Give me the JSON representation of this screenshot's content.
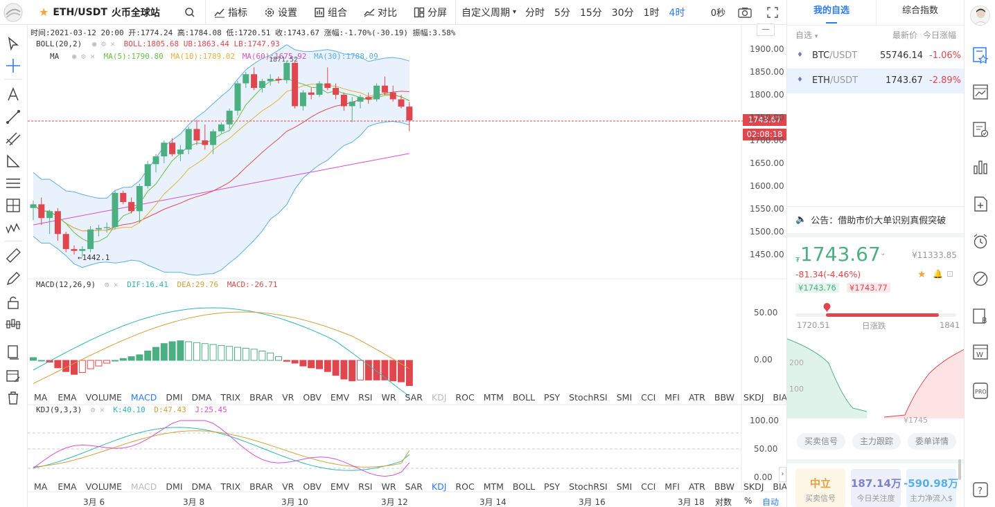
{
  "topbar": {
    "symbol": "ETH/USDT",
    "exchange": "火币全球站",
    "indicators": "指标",
    "settings": "设置",
    "combo": "组合",
    "compare": "对比",
    "split": "分屏",
    "custom_period": "自定义周期",
    "periods": [
      "分时",
      "5分",
      "15分",
      "30分",
      "1时",
      "4时"
    ],
    "active_period": "4时",
    "countdown": "0秒"
  },
  "info": {
    "ohlc": "时间:2021-03-12 20:00  开:1774.24  高:1784.08  低:1720.51  收:1743.67  涨幅:-1.70%(-30.19)  振幅:3.58%",
    "boll_name": "BOLL(20,2)",
    "boll_vals": "BOLL:1805.68  UB:1863.44  LB:1747.93",
    "ma_name": "MA",
    "ma5": "MA(5):1790.80",
    "ma10": "MA(10):1789.02",
    "ma60": "MA(60):1675.92",
    "ma30": "MA(30):1788.09",
    "high_mark": "1871.52",
    "low_mark": "←1442.1",
    "macd_name": "MACD(12,26,9)",
    "dif": "DIF:16.41",
    "dea": "DEA:29.76",
    "macd": "MACD:-26.71",
    "kdj_name": "KDJ(9,3,3)",
    "k": "K:40.10",
    "d": "D:47.43",
    "j": "J:25.45"
  },
  "price_axis": [
    "1900.00",
    "1850.00",
    "1800.00",
    "1750.00",
    "1700.00",
    "1650.00",
    "1600.00",
    "1550.00",
    "1500.00",
    "1450.00"
  ],
  "price_tag": "1743.67",
  "timer_tag": "02:08:18",
  "macd_axis": [
    "50.00",
    "0.00"
  ],
  "kdj_axis": [
    "100.00",
    "50.00",
    "0.00"
  ],
  "indicator_tabs": [
    "MA",
    "EMA",
    "VOLUME",
    "MACD",
    "DMI",
    "DMA",
    "TRIX",
    "BRAR",
    "VR",
    "OBV",
    "EMV",
    "RSI",
    "WR",
    "SAR",
    "KDJ",
    "ROC",
    "MTM",
    "BOLL",
    "PSY",
    "StochRSI",
    "SMI",
    "CCI",
    "MFI",
    "ATR",
    "BBW",
    "SKDJ",
    "BIAS",
    "DPO",
    "AO"
  ],
  "dates": [
    "3月 6",
    "3月 8",
    "3月 10",
    "3月 12",
    "3月 14",
    "3月 16",
    "3月 18"
  ],
  "bottom_right": {
    "log": "对数",
    "pct": "%",
    "auto": "自动"
  },
  "colors": {
    "up": "#4caf82",
    "down": "#e0464e",
    "accent": "#2d7bf4",
    "boll": "#5aaee6",
    "ma5": "#6bbf4a",
    "ma10": "#e2b33a",
    "ma30": "#e34c56",
    "ma60": "#d84fd0"
  },
  "chart_data": {
    "type": "candlestick",
    "candles": [
      [
        1552,
        1568,
        1525,
        1560
      ],
      [
        1560,
        1575,
        1515,
        1530
      ],
      [
        1530,
        1548,
        1495,
        1545
      ],
      [
        1545,
        1552,
        1480,
        1495
      ],
      [
        1495,
        1500,
        1455,
        1462
      ],
      [
        1462,
        1470,
        1450,
        1458
      ],
      [
        1458,
        1468,
        1445,
        1462
      ],
      [
        1462,
        1512,
        1455,
        1505
      ],
      [
        1505,
        1515,
        1490,
        1508
      ],
      [
        1508,
        1520,
        1498,
        1510
      ],
      [
        1510,
        1590,
        1505,
        1585
      ],
      [
        1585,
        1590,
        1560,
        1565
      ],
      [
        1565,
        1575,
        1540,
        1545
      ],
      [
        1545,
        1605,
        1520,
        1600
      ],
      [
        1600,
        1655,
        1595,
        1648
      ],
      [
        1648,
        1670,
        1630,
        1665
      ],
      [
        1665,
        1700,
        1650,
        1695
      ],
      [
        1695,
        1705,
        1665,
        1670
      ],
      [
        1670,
        1690,
        1655,
        1680
      ],
      [
        1680,
        1730,
        1670,
        1725
      ],
      [
        1725,
        1745,
        1690,
        1700
      ],
      [
        1700,
        1735,
        1680,
        1690
      ],
      [
        1690,
        1725,
        1670,
        1720
      ],
      [
        1720,
        1740,
        1715,
        1735
      ],
      [
        1735,
        1770,
        1725,
        1765
      ],
      [
        1765,
        1830,
        1755,
        1825
      ],
      [
        1825,
        1850,
        1815,
        1845
      ],
      [
        1845,
        1860,
        1810,
        1815
      ],
      [
        1815,
        1835,
        1805,
        1830
      ],
      [
        1830,
        1845,
        1820,
        1835
      ],
      [
        1835,
        1840,
        1825,
        1832
      ],
      [
        1832,
        1875,
        1825,
        1870
      ],
      [
        1870,
        1872,
        1770,
        1775
      ],
      [
        1775,
        1810,
        1765,
        1805
      ],
      [
        1805,
        1815,
        1790,
        1800
      ],
      [
        1800,
        1830,
        1795,
        1825
      ],
      [
        1825,
        1860,
        1810,
        1815
      ],
      [
        1815,
        1825,
        1790,
        1800
      ],
      [
        1800,
        1805,
        1765,
        1775
      ],
      [
        1775,
        1795,
        1740,
        1785
      ],
      [
        1785,
        1800,
        1770,
        1795
      ],
      [
        1795,
        1805,
        1780,
        1790
      ],
      [
        1790,
        1825,
        1785,
        1820
      ],
      [
        1820,
        1840,
        1800,
        1805
      ],
      [
        1805,
        1820,
        1785,
        1790
      ],
      [
        1790,
        1800,
        1770,
        1774
      ],
      [
        1774,
        1784,
        1720,
        1744
      ]
    ],
    "macd_hist": [
      3,
      0,
      -2,
      -8,
      -12,
      -15,
      -13,
      -9,
      -6,
      -3,
      0,
      2,
      4,
      6,
      10,
      14,
      18,
      20,
      21,
      20,
      19,
      18,
      17,
      16,
      15,
      14,
      13,
      12,
      10,
      8,
      4,
      -1,
      -3,
      -6,
      -8,
      -9,
      -12,
      -16,
      -20,
      -22,
      -21,
      -21,
      -21,
      -21,
      -22,
      -23,
      -27
    ],
    "xlabels": [
      "3月 6",
      "3月 8",
      "3月 10",
      "3月 12",
      "3月 14",
      "3月 16",
      "3月 18"
    ]
  },
  "rightpanel": {
    "tab_watch": "我的自选",
    "tab_index": "综合指数",
    "col_watch": "自选",
    "col_price": "最新价",
    "col_change": "今日涨幅",
    "rows": [
      {
        "base": "BTC",
        "quote": "/USDT",
        "price": "55746.14",
        "change": "-1.06%"
      },
      {
        "base": "ETH",
        "quote": "/USDT",
        "price": "1743.67",
        "change": "-2.89%"
      }
    ],
    "notice": "公告：借助市价大单识别真假突破",
    "big_price": "1743.67",
    "cny": "¥11333.85",
    "change": "-81.34(-4.46%)",
    "bid": "¥1743.76",
    "ask": "¥1743.77",
    "range_low": "1720.51",
    "range_label": "日涨跌",
    "range_high": "1841",
    "depth_200": "200",
    "depth_100": "100",
    "depth_price": "¥1745",
    "btn1": "买卖信号",
    "btn2": "主力跟踪",
    "btn3": "委单详情",
    "card1_v": "中立",
    "card1_l": "买卖信号",
    "card2_v": "187.14万",
    "card2_l": "今日关注度",
    "card3_v": "-590.98万",
    "card3_l": "主力净流入$"
  }
}
